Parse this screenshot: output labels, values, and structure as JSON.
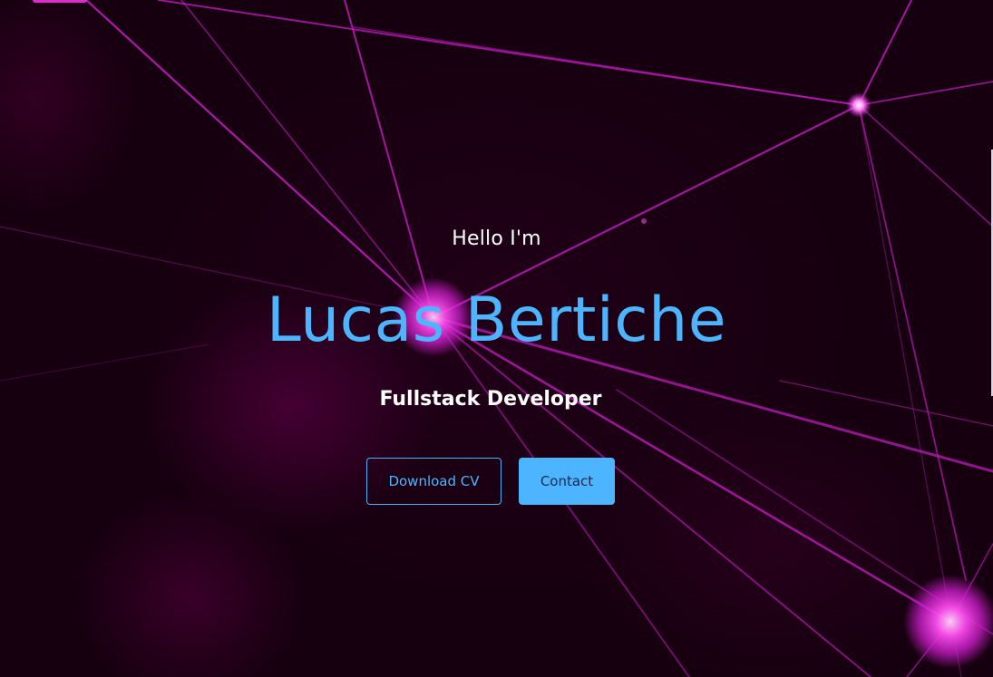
{
  "hero": {
    "greeting": "Hello I'm",
    "name": "Lucas Bertiche",
    "role": "Fullstack Developer"
  },
  "buttons": {
    "download_cv": "Download CV",
    "contact": "Contact"
  },
  "colors": {
    "accent": "#4db5ff",
    "background": "#16000f",
    "network": "#d21fd0"
  }
}
